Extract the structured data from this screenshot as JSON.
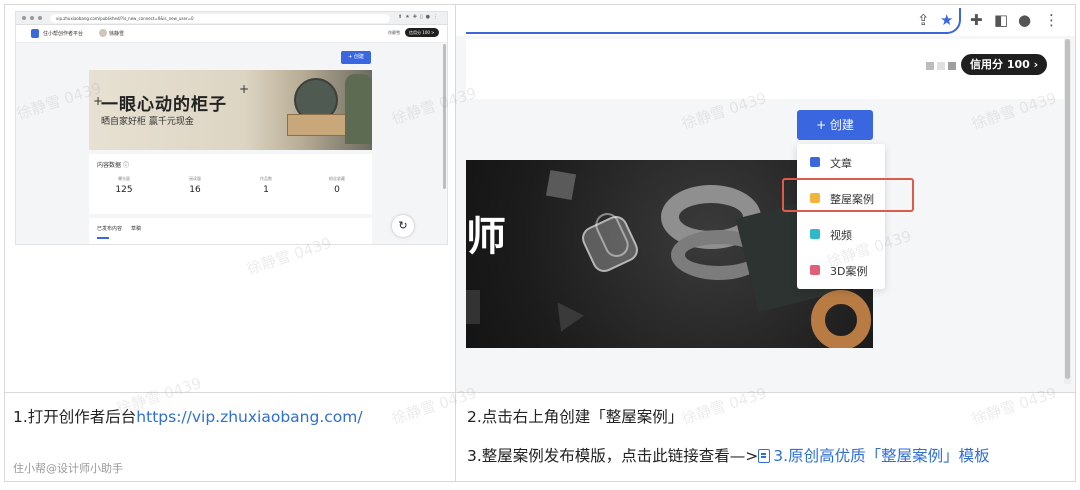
{
  "step1": {
    "caption_text": "1.打开创作者后台",
    "caption_link": "https://vip.zhuxiaobang.com/"
  },
  "step2": {
    "caption": "2.点击右上角创建「整屋案例」"
  },
  "step3": {
    "caption_text": "3.整屋案例发布模版，点击此链接查看—>",
    "link_label": "3.原创高优质「整屋案例」模板"
  },
  "credit": "住小帮@设计师小助手",
  "watermark": "徐静雪 0439",
  "left_screenshot": {
    "url": "vip.zhuxiaobang.com/published/?is_new_connect=0&is_new_user=0",
    "brand": "住小帮创作者平台",
    "user_name": "徐静雪",
    "header_name": "徐静雪",
    "credit_badge": "信用分 100 >",
    "create_button": "+ 创建",
    "banner_title": "一眼心动的柜子",
    "banner_subtitle": "晒自家好柜 赢千元现金",
    "content_title": "内容数据",
    "stats": [
      {
        "label": "曝光量",
        "value": "125"
      },
      {
        "label": "阅读量",
        "value": "16"
      },
      {
        "label": "作品数",
        "value": "1"
      },
      {
        "label": "粉丝收藏",
        "value": "0"
      }
    ],
    "tabs": [
      "已发布内容",
      "草稿"
    ]
  },
  "right_screenshot": {
    "credit_badge": "信用分 100 ›",
    "create_button": "+ 创建",
    "banner_text": "师",
    "menu": [
      {
        "label": "文章",
        "color": "#3a66e0"
      },
      {
        "label": "整屋案例",
        "color": "#f2b53c"
      },
      {
        "label": "视频",
        "color": "#2fb8c8"
      },
      {
        "label": "3D案例",
        "color": "#e0607a"
      }
    ]
  },
  "colors": {
    "accent_blue": "#3a66e0",
    "highlight_red": "#e05a4a",
    "link_blue": "#2f6fd4"
  },
  "icons": [
    "share-icon",
    "star-icon",
    "extension-icon",
    "sidepanel-icon",
    "profile-icon",
    "more-icon",
    "help-icon",
    "document-icon"
  ]
}
